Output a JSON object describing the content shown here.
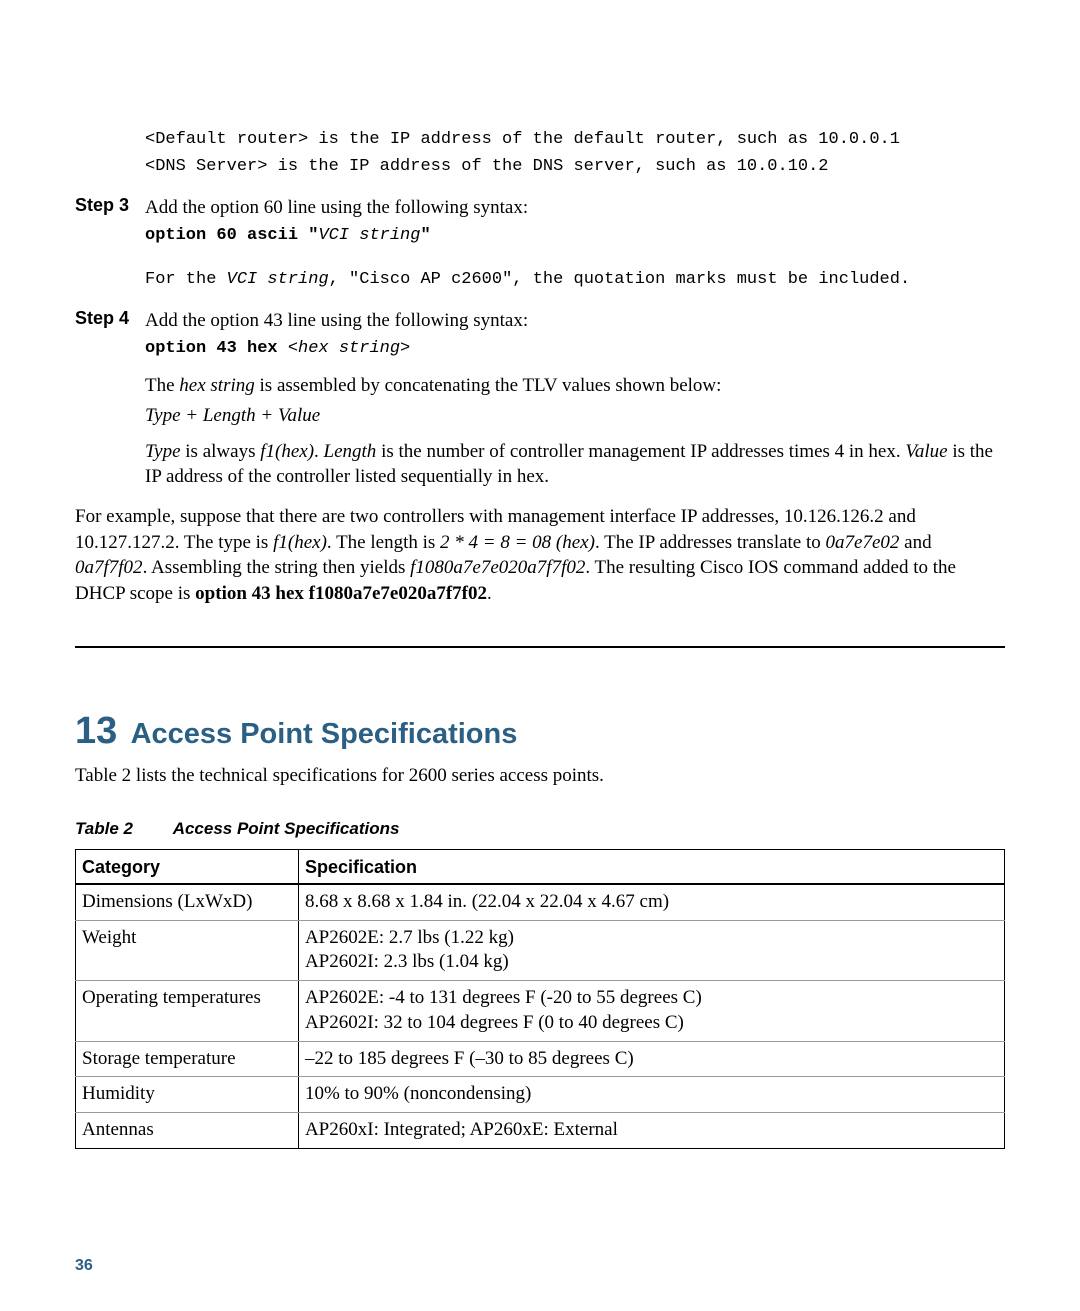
{
  "intro_code": {
    "line1": "<Default router> is the IP address of the default router, such as 10.0.0.1",
    "line2": "<DNS Server> is the IP address of the DNS server, such as 10.0.10.2"
  },
  "step3": {
    "label": "Step 3",
    "text": "Add the option 60 line using the following syntax:",
    "cmd_prefix": "option 60 ascii \"",
    "cmd_var": "VCI string",
    "cmd_suffix": "\"",
    "note_prefix": "For the ",
    "note_var": "VCI string",
    "note_suffix": ", \"Cisco AP c2600\", the quotation marks must be included."
  },
  "step4": {
    "label": "Step 4",
    "text": "Add the option 43 line using the following syntax:",
    "cmd_prefix": "option 43 hex ",
    "cmd_var": "<hex string>",
    "p1_a": "The ",
    "p1_b": "hex string",
    "p1_c": " is assembled by concatenating the TLV values shown below:",
    "tlv": "Type + Length + Value",
    "p2_a": "Type",
    "p2_b": " is always ",
    "p2_c": "f1(hex)",
    "p2_d": ". ",
    "p2_e": "Length",
    "p2_f": " is the number of controller management IP addresses times 4 in hex. ",
    "p2_g": "Value",
    "p2_h": " is the IP address of the controller listed sequentially in hex."
  },
  "example": {
    "a": "For example, suppose that there are two controllers with management interface IP addresses, 10.126.126.2 and 10.127.127.2. The type is ",
    "b": "f1(hex)",
    "c": ". The length is ",
    "d": "2 * 4 = 8 = 08 (hex)",
    "e": ". The IP addresses translate to ",
    "f": "0a7e7e02",
    "g": " and ",
    "h": "0a7f7f02",
    "i": ". Assembling the string then yields ",
    "j": "f1080a7e7e020a7f7f02",
    "k": ". The resulting Cisco IOS command added to the DHCP scope is ",
    "l": "option 43 hex f1080a7e7e020a7f7f02",
    "m": "."
  },
  "section": {
    "number": "13",
    "title": "Access Point Specifications",
    "lead": "Table 2 lists the technical specifications for 2600 series access points."
  },
  "table": {
    "caption_label": "Table 2",
    "caption_title": "Access Point Specifications",
    "h1": "Category",
    "h2": "Specification",
    "rows": [
      {
        "cat": "Dimensions (LxWxD)",
        "spec": "8.68 x 8.68 x 1.84 in. (22.04 x 22.04 x 4.67 cm)"
      },
      {
        "cat": "Weight",
        "spec": "AP2602E: 2.7 lbs (1.22 kg)\nAP2602I: 2.3 lbs (1.04 kg)"
      },
      {
        "cat": "Operating temperatures",
        "spec": "AP2602E: -4 to 131 degrees F (-20 to 55 degrees C)\nAP2602I: 32 to 104 degrees F (0 to 40 degrees C)"
      },
      {
        "cat": "Storage temperature",
        "spec": "–22 to 185 degrees F (–30 to 85 degrees C)"
      },
      {
        "cat": "Humidity",
        "spec": "10% to 90% (noncondensing)"
      },
      {
        "cat": "Antennas",
        "spec": "AP260xI: Integrated; AP260xE: External"
      }
    ]
  },
  "footer": {
    "page_number": "36"
  }
}
